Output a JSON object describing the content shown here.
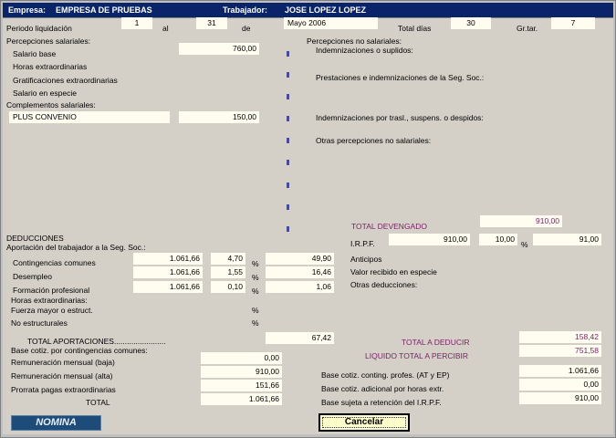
{
  "header": {
    "empresa_label": "Empresa:",
    "empresa_value": "EMPRESA DE PRUEBAS",
    "trabajador_label": "Trabajador:",
    "trabajador_value": "JOSE LOPEZ LOPEZ"
  },
  "periodo": {
    "label": "Periodo liquidación",
    "from": "1",
    "al": "al",
    "to": "31",
    "de": "de",
    "month_year": "Mayo  2006",
    "total_dias_label": "Total días",
    "total_dias": "30",
    "grtar_label": "Gr.tar.",
    "grtar": "7"
  },
  "percepciones_salariales": {
    "title": "Percepciones salariales:",
    "salario_base": "Salario base",
    "salario_base_value": "760,00",
    "horas_extra": "Horas extraordinarias",
    "gratificaciones": "Gratificaciones extraordinarias",
    "salario_especie": "Salario en especie",
    "complementos": "Complementos salariales:",
    "complemento_name": "PLUS CONVENIO",
    "complemento_value": "150,00"
  },
  "percepciones_no_salariales": {
    "title": "Percepciones no salariales:",
    "indemnizaciones": "Indemnizaciones o suplidos:",
    "prestaciones": "Prestaciones e indemnizaciones de la Seg. Soc.:",
    "indemn_traslados": "Indemnizaciones por trasl., suspens. o despidos:",
    "otras": "Otras percepciones no salariales:"
  },
  "devengado": {
    "label": "TOTAL DEVENGADO",
    "value": "910,00"
  },
  "irpf": {
    "label": "I.R.P.F.",
    "base": "910,00",
    "pct": "10,00",
    "pct_sign": "%",
    "amount": "91,00"
  },
  "deducciones": {
    "title": "DEDUCCIONES",
    "subtitle": "Aportación del trabajador a la Seg. Soc.:",
    "rows": [
      {
        "label": "Contingencias comunes",
        "base": "1.061,66",
        "pct": "4,70",
        "sign": "%",
        "amount": "49,90"
      },
      {
        "label": "Desempleo",
        "base": "1.061,66",
        "pct": "1,55",
        "sign": "%",
        "amount": "16,46"
      },
      {
        "label": "Formación profesional",
        "base": "1.061,66",
        "pct": "0,10",
        "sign": "%",
        "amount": "1,06"
      }
    ],
    "horas_extra": "Horas extraordinarias:",
    "fuerza_mayor": "Fuerza mayor o estruct.",
    "fuerza_mayor_sign": "%",
    "no_estructurales": "No estructurales",
    "no_estructurales_sign": "%",
    "total_aportaciones_label": "TOTAL APORTACIONES........................",
    "total_aportaciones": "67,42",
    "anticipos": "Anticipos",
    "valor_especie": "Valor recibido en especie",
    "otras": "Otras deducciones:"
  },
  "totales": {
    "deducir_label": "TOTAL A DEDUCIR",
    "deducir": "158,42",
    "liquido_label": "LIQUIDO TOTAL A PERCIBIR",
    "liquido": "751,58"
  },
  "bases": {
    "title": "Base cotiz. por contingencias comunes:",
    "baja_label": "Remuneración mensual (baja)",
    "baja": "0,00",
    "alta_label": "Remuneración mensual (alta)",
    "alta": "910,00",
    "prorrata_label": "Prorrata pagas extraordinarias",
    "prorrata": "151,66",
    "total_label": "TOTAL",
    "total": "1.061,66",
    "at_ep_label": "Base cotiz. conting. profes. (AT y EP)",
    "at_ep": "1.061,66",
    "horas_label": "Base cotiz. adicional por horas extr.",
    "horas": "0,00",
    "irpf_label": "Base sujeta a retención del I.R.P.F.",
    "irpf": "910,00"
  },
  "buttons": {
    "nomina": "NOMINA",
    "cancelar": "Cancelar"
  }
}
